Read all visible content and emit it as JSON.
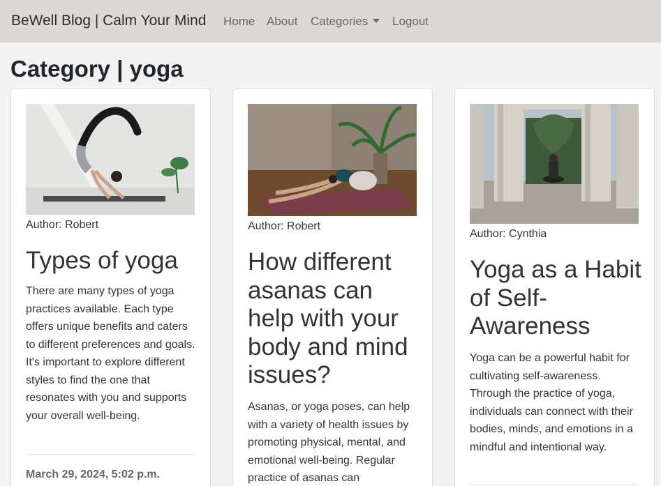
{
  "navbar": {
    "brand": "BeWell Blog | Calm Your Mind",
    "links": [
      {
        "label": "Home"
      },
      {
        "label": "About"
      },
      {
        "label": "Categories"
      },
      {
        "label": "Logout"
      }
    ]
  },
  "page": {
    "title": "Category | yoga"
  },
  "posts": [
    {
      "image_alt": "Woman doing a scorpion yoga pose",
      "author": "Author: Robert",
      "title": "Types of yoga",
      "excerpt": "There are many types of yoga practices available. Each type offers unique benefits and caters to different preferences and goals. It's important to explore different styles to find the one that resonates with you and supports your overall well-being.",
      "date": "March 29, 2024, 5:02 p.m."
    },
    {
      "image_alt": "Woman in child's pose on yoga mat",
      "author": "Author: Robert",
      "title": "How different asanas can help with your body and mind issues?",
      "excerpt": "Asanas, or yoga poses, can help with a variety of health issues by promoting physical, mental, and emotional well-being. Regular practice of asanas can",
      "date": ""
    },
    {
      "image_alt": "Person meditating between stone columns",
      "author": "Author: Cynthia",
      "title": "Yoga as a Habit of Self-Awareness",
      "excerpt": "Yoga can be a powerful habit for cultivating self-awareness. Through the practice of yoga, individuals can connect with their bodies, minds, and emotions in a mindful and intentional way.",
      "date": ""
    }
  ]
}
